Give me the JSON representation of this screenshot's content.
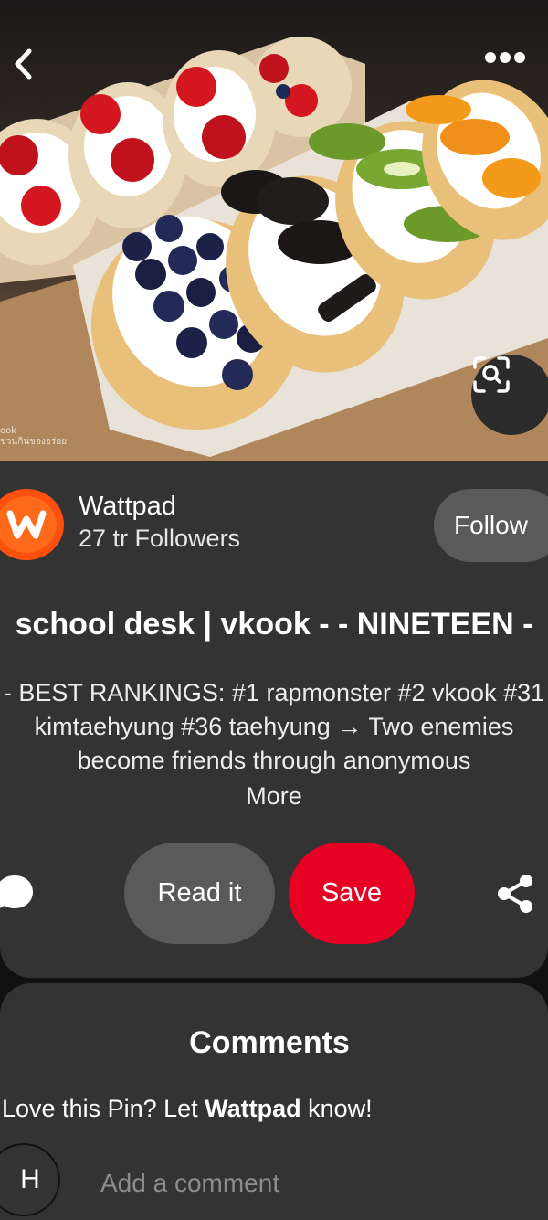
{
  "pin_image": {
    "semantic": "dessert tacos with strawberries, blueberries, oreo, kiwi and orange",
    "watermark_line1": "ook",
    "watermark_line2": "ชวนกินของอร่อย"
  },
  "top_bar": {
    "back_icon": "chevron-left-icon",
    "more_icon": "more-horizontal-icon"
  },
  "visual_search_icon": "lens-icon",
  "creator": {
    "avatar_letter": "w",
    "name": "Wattpad",
    "followers": "27 tr Followers",
    "follow_label": "Follow"
  },
  "pin": {
    "title": "school desk | vkook - - NINETEEN -",
    "description": "- BEST RANKINGS: #1 rapmonster #2 vkook #31 kimtaehyung #36 taehyung → Two enemies become friends through anonymous",
    "more_label": "More"
  },
  "actions": {
    "comment_icon": "comment-bubble-icon",
    "read_label": "Read it",
    "save_label": "Save",
    "share_icon": "share-icon"
  },
  "comments": {
    "title": "Comments",
    "prompt_before": "Love this Pin? Let ",
    "prompt_name": "Wattpad",
    "prompt_after": " know!",
    "user_initial": "H",
    "input_placeholder": "Add a comment"
  },
  "colors": {
    "background": "#111111",
    "card": "#333333",
    "save": "#e60023",
    "secondary_button": "#5a5a5a",
    "wattpad_orange": "#ff500f"
  }
}
